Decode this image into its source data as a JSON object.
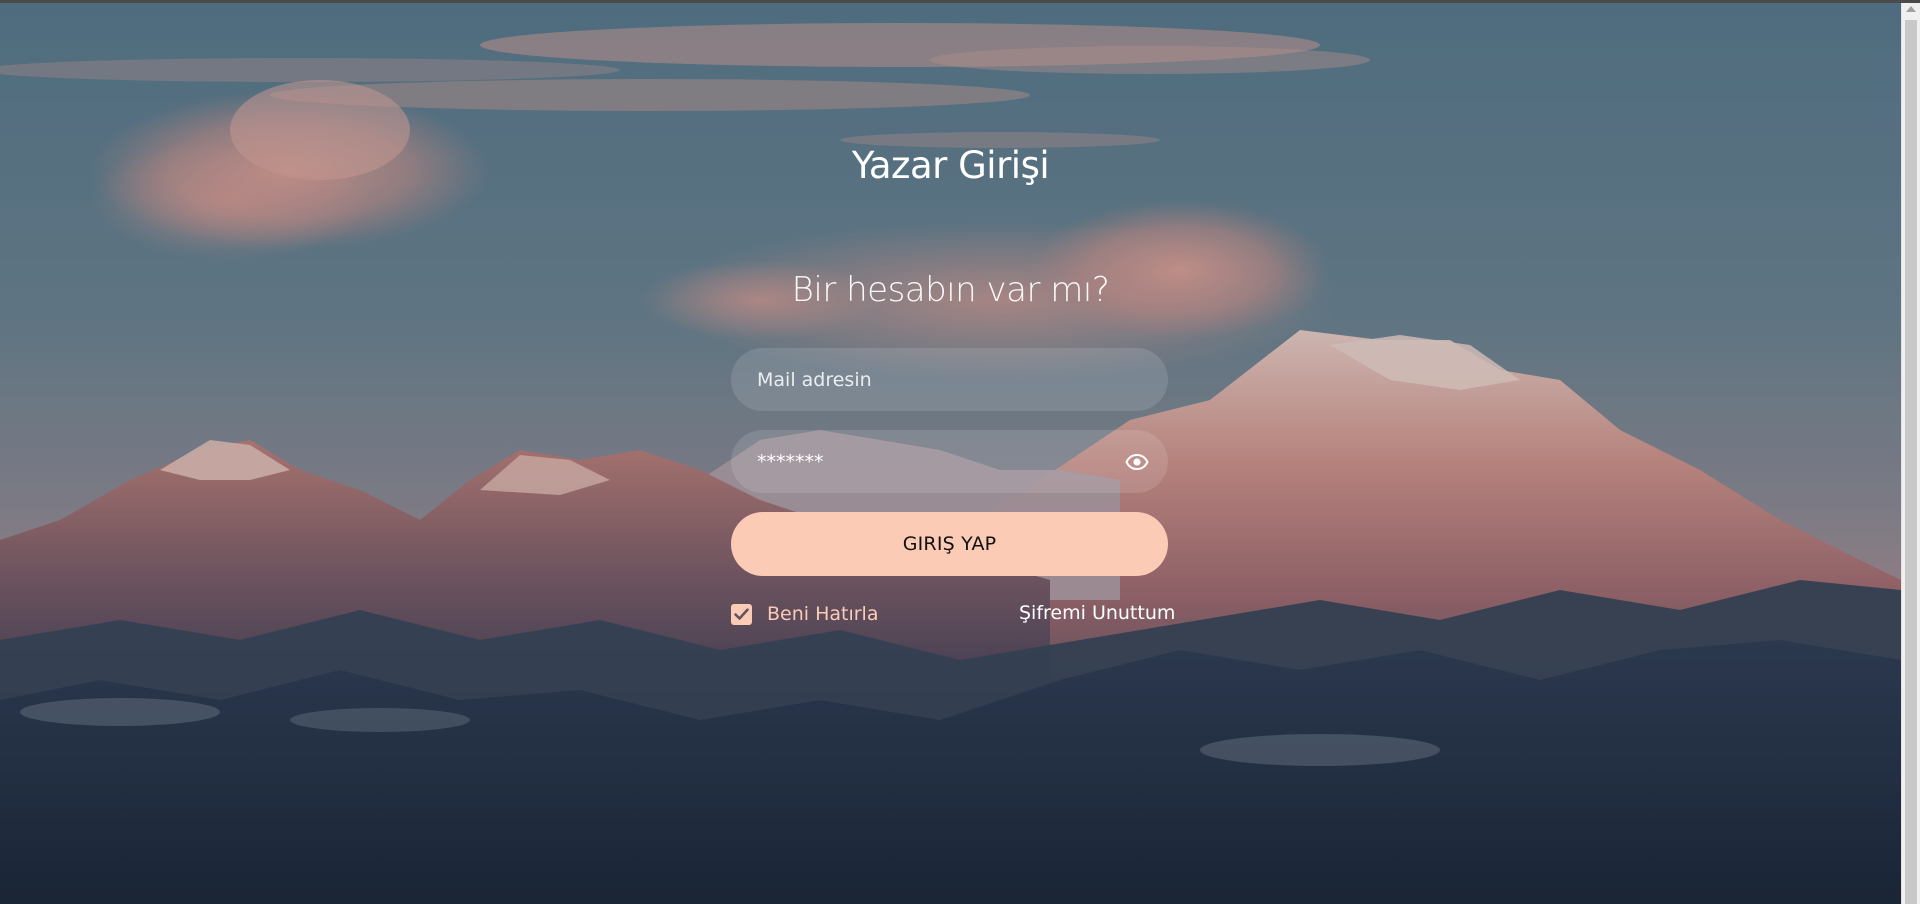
{
  "page": {
    "title": "Yazar Girişi",
    "subtitle": "Bir hesabın var mı?"
  },
  "form": {
    "email_placeholder": "Mail adresin",
    "email_value": "",
    "password_value": "*******",
    "password_icon": "eye-icon",
    "submit_label": "GIRIŞ YAP",
    "remember_label": "Beni Hatırla",
    "remember_checked": true,
    "forgot_label": "Şifremi Unuttum"
  },
  "colors": {
    "accent": "#fccbb6",
    "text": "#ffffff",
    "button_text": "#111111"
  }
}
